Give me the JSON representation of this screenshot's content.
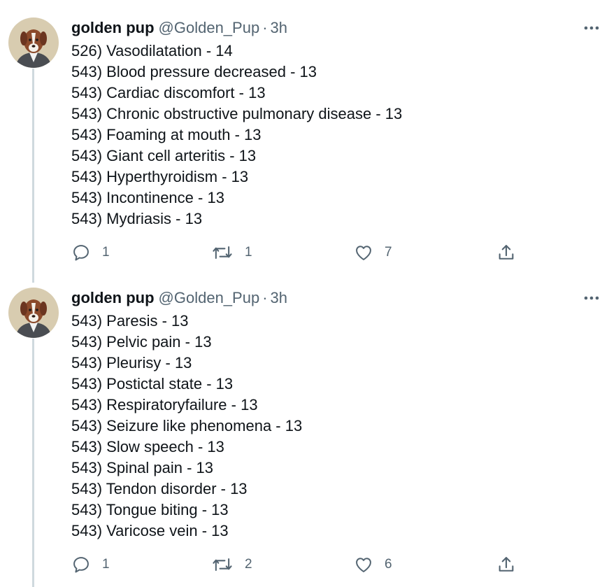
{
  "tweets": [
    {
      "author": {
        "name": "golden pup",
        "handle": "@Golden_Pup",
        "separator": "·",
        "time": "3h"
      },
      "lines": [
        "526) Vasodilatation - 14",
        "543) Blood pressure decreased - 13",
        "543) Cardiac discomfort - 13",
        "543) Chronic obstructive pulmonary disease - 13",
        "543) Foaming at mouth - 13",
        "543) Giant cell arteritis - 13",
        "543) Hyperthyroidism - 13",
        "543) Incontinence - 13",
        "543) Mydriasis - 13"
      ],
      "stats": {
        "replies": "1",
        "retweets": "1",
        "likes": "7"
      }
    },
    {
      "author": {
        "name": "golden pup",
        "handle": "@Golden_Pup",
        "separator": "·",
        "time": "3h"
      },
      "lines": [
        "543) Paresis - 13",
        "543) Pelvic pain - 13",
        "543) Pleurisy - 13",
        "543) Postictal state - 13",
        "543) Respiratoryfailure - 13",
        "543) Seizure like phenomena - 13",
        "543) Slow speech - 13",
        "543) Spinal pain - 13",
        "543) Tendon disorder - 13",
        "543) Tongue biting - 13",
        "543) Varicose vein - 13"
      ],
      "stats": {
        "replies": "1",
        "retweets": "2",
        "likes": "6"
      }
    }
  ],
  "icons": [
    "avatar-dog",
    "more-icon",
    "reply-icon",
    "retweet-icon",
    "like-icon",
    "share-icon"
  ],
  "colors": {
    "text": "#0f1419",
    "secondary": "#536471",
    "thread_line": "#cfd9de"
  }
}
